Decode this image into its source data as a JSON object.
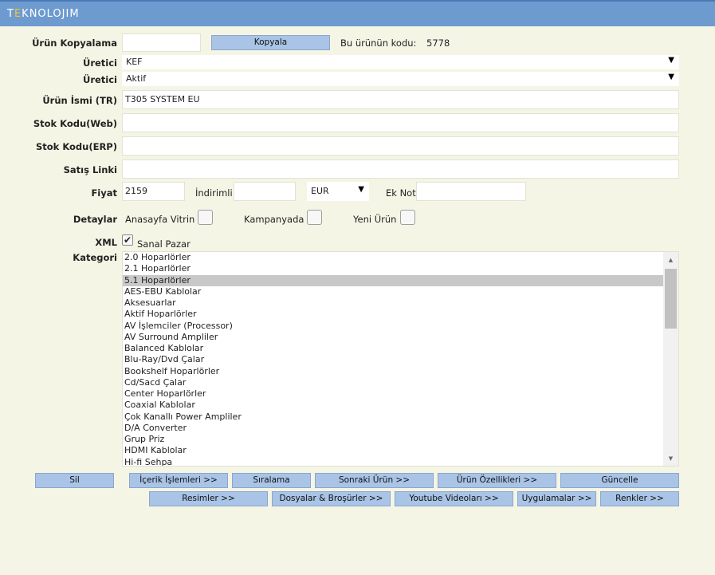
{
  "header": {
    "logo_pre": "T",
    "logo_e": "E",
    "logo_post": "KNOLOJIM"
  },
  "copy": {
    "label": "Ürün Kopyalama",
    "input_value": "",
    "button": "Kopyala",
    "code_label": "Bu ürünün kodu:",
    "code_value": "5778"
  },
  "manufacturer": {
    "label": "Üretici",
    "value": "KEF"
  },
  "status": {
    "label": "Üretici",
    "value": "Aktif"
  },
  "product_name": {
    "label": "Ürün İsmi (TR)",
    "value": "T305 SYSTEM EU"
  },
  "stock_web": {
    "label": "Stok Kodu(Web)",
    "value": ""
  },
  "stock_erp": {
    "label": "Stok Kodu(ERP)",
    "value": ""
  },
  "sales_link": {
    "label": "Satış Linki",
    "value": ""
  },
  "price": {
    "label": "Fiyat",
    "value": "2159",
    "discount_label": "İndirimli",
    "discount_value": "",
    "currency": "EUR",
    "extra_label": "Ek Not",
    "extra_value": ""
  },
  "details": {
    "label": "Detaylar",
    "homepage": "Anasayfa Vitrin",
    "campaign": "Kampanyada",
    "new_product": "Yeni Ürün",
    "homepage_checked": false,
    "campaign_checked": false,
    "new_product_checked": false
  },
  "xml": {
    "label": "XML",
    "option": "Sanal Pazar",
    "checked": true
  },
  "category": {
    "label": "Kategori",
    "selected_index": 2,
    "items": [
      "2.0 Hoparlörler",
      "2.1 Hoparlörler",
      "5.1 Hoparlörler",
      "AES-EBU Kablolar",
      "Aksesuarlar",
      "Aktif Hoparlörler",
      "AV İşlemciler (Processor)",
      "AV Surround Ampliler",
      "Balanced Kablolar",
      "Blu-Ray/Dvd Çalar",
      "Bookshelf Hoparlörler",
      "Cd/Sacd Çalar",
      "Center Hoparlörler",
      "Coaxial Kablolar",
      "Çok Kanallı Power Ampliler",
      "D/A Converter",
      "Grup Priz",
      "HDMI Kablolar",
      "Hi-fi Sehpa"
    ]
  },
  "actions": {
    "delete": "Sil",
    "content_ops": "İçerik İşlemleri >>",
    "sorting": "Sıralama",
    "next_product": "Sonraki Ürün >>",
    "product_features": "Ürün Özellikleri >>",
    "update": "Güncelle",
    "images": "Resimler >>",
    "files": "Dosyalar & Broşürler >>",
    "youtube": "Youtube Videoları >>",
    "apps": "Uygulamalar >>",
    "colors": "Renkler >>"
  },
  "colors": {
    "header": "#6d9bcf",
    "button": "#a9c4e6",
    "background": "#f5f5e6",
    "selected_row": "#c8c8c8"
  }
}
